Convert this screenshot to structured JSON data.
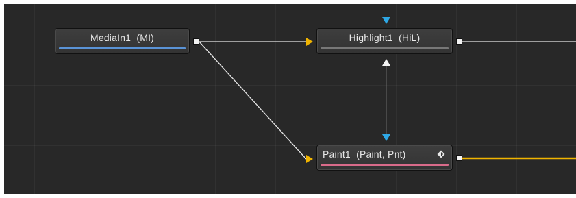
{
  "colors": {
    "canvas_bg": "#282828",
    "main_wire": "#f0b400",
    "wire": "#e6e6e6",
    "input_arrow": "#f0b400",
    "effect_mask_arrow": "#2ea8e6",
    "media_bar": "#5a93d6",
    "highlight_bar": "#777777",
    "paint_bar": "#d96b8a"
  },
  "nodes": [
    {
      "id": "mediain1",
      "label": "MediaIn1  (MI)",
      "color_bar": "#5a93d6"
    },
    {
      "id": "highlight1",
      "label": "Highlight1  (HiL)",
      "color_bar": "#777777"
    },
    {
      "id": "paint1",
      "label": "Paint1  (Paint, Pnt)",
      "color_bar": "#d96b8a",
      "icon": "keyframe-diamond-icon"
    }
  ]
}
